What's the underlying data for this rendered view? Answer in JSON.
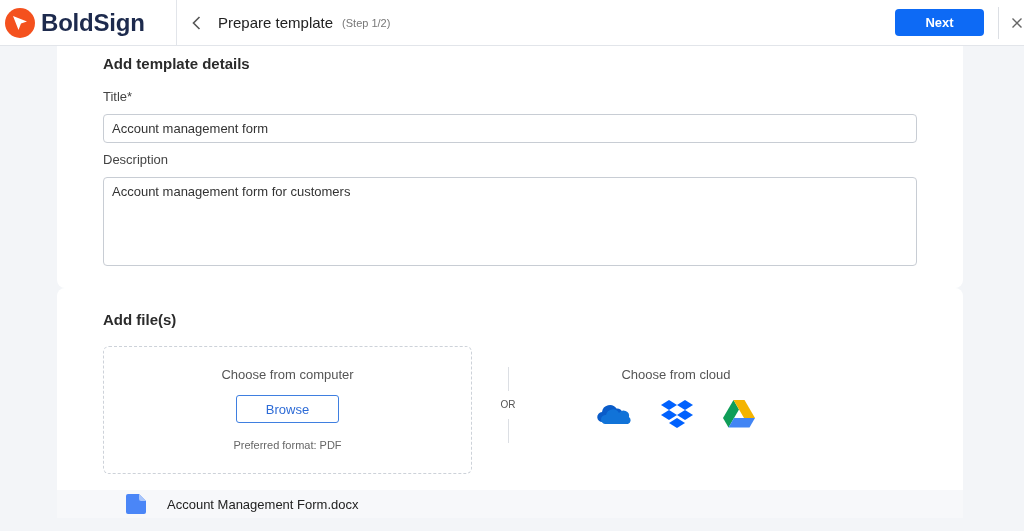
{
  "header": {
    "brand": "BoldSign",
    "page_title": "Prepare template",
    "step": "(Step 1/2)",
    "next_button": "Next"
  },
  "template_details": {
    "heading": "Add template details",
    "fields": [
      {
        "kind": "input",
        "label": "Title*",
        "value": "Account management form"
      },
      {
        "kind": "textarea",
        "label": "Description",
        "value": "Account management form for customers"
      }
    ]
  },
  "files": {
    "heading": "Add file(s)",
    "computer": {
      "heading": "Choose from computer",
      "button": "Browse",
      "hint": "Preferred format: PDF"
    },
    "separator": "OR",
    "cloud": {
      "heading": "Choose from cloud",
      "providers": [
        {
          "kind": "onedrive"
        },
        {
          "kind": "dropbox"
        },
        {
          "kind": "drive"
        }
      ]
    },
    "file_list": [
      {
        "name": "Account Management Form.docx"
      }
    ]
  }
}
